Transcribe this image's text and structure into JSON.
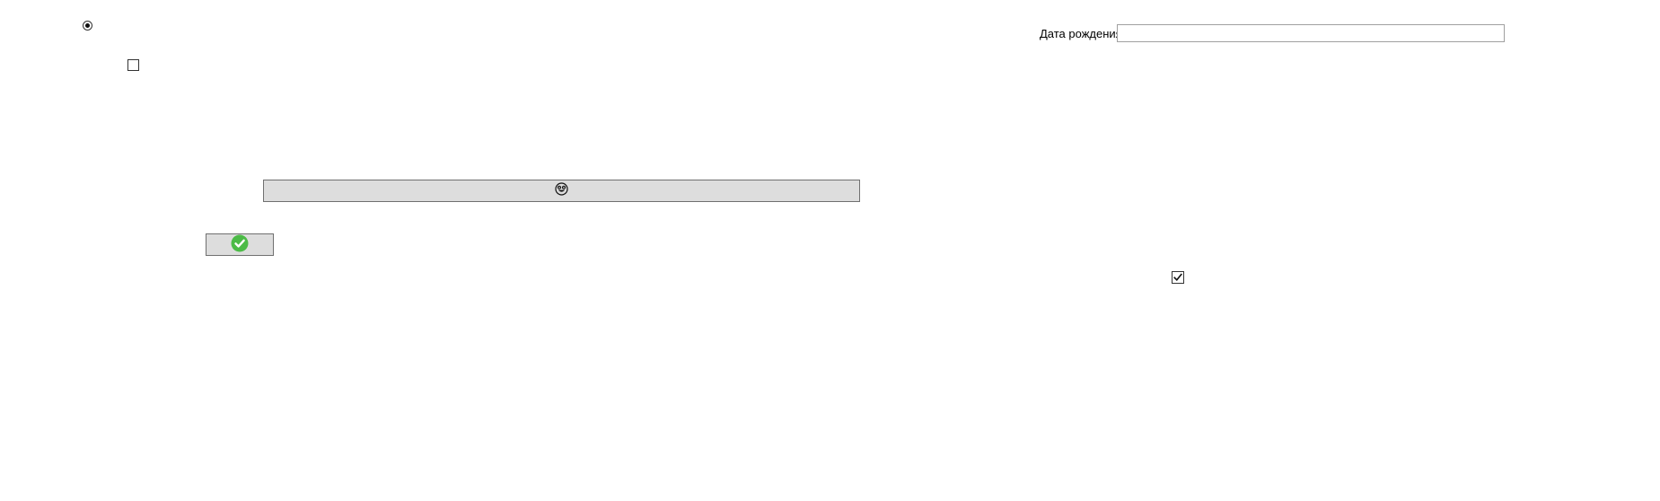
{
  "form": {
    "radio_option": {
      "selected": true
    },
    "checkbox_unchecked": {
      "checked": false
    },
    "checkbox_checked": {
      "checked": true
    },
    "emoji_button": {
      "icon": "smiley-face-icon",
      "label": ""
    },
    "confirm_button": {
      "icon": "green-checkmark-icon",
      "label": "",
      "icon_color": "#4cbb47"
    },
    "birth_date": {
      "label": "Дата рождения",
      "value": "",
      "placeholder": ""
    }
  },
  "colors": {
    "button_face": "#dddddd",
    "button_border": "#707070",
    "input_border": "#a0a0a0",
    "check_green": "#4cbb47"
  }
}
